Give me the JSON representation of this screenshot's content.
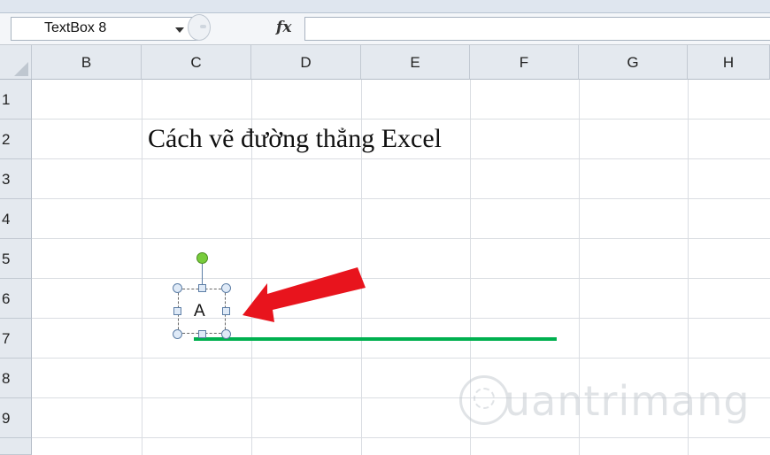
{
  "formula_bar": {
    "name_box_value": "TextBox 8",
    "fx_label": "fx",
    "formula_value": ""
  },
  "columns": [
    "B",
    "C",
    "D",
    "E",
    "F",
    "G",
    "H"
  ],
  "rows": [
    "1",
    "2",
    "3",
    "4",
    "5",
    "6",
    "7",
    "8",
    "9"
  ],
  "cells": {
    "C2": "Cách vẽ đường thẳng Excel"
  },
  "textbox": {
    "name": "TextBox 8",
    "text": "A"
  },
  "drawing": {
    "line_color": "#00b04f",
    "arrow_color": "#e8141d",
    "rotate_handle_color": "#78cc3c"
  },
  "watermark": {
    "text": "uantrimang",
    "logo_icon": "lightbulb-q-icon"
  }
}
